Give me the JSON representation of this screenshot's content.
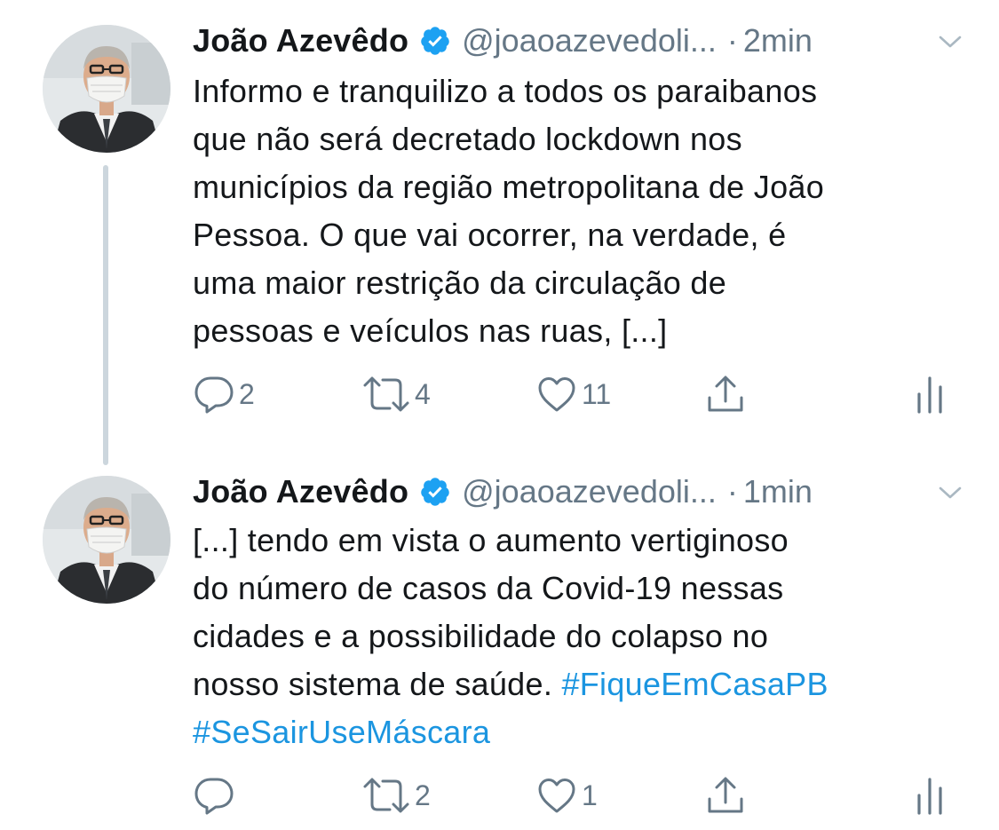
{
  "tweets": [
    {
      "author_name": "João Azevêdo",
      "handle": "@joaoazevedoli...",
      "separator": "·",
      "time": "2min",
      "text_lines": [
        "Informo e tranquilizo a todos os paraibanos",
        "que não será decretado lockdown nos",
        "municípios da região metropolitana de João",
        "Pessoa. O que vai ocorrer, na verdade, é",
        "uma maior restrição da circulação de",
        "pessoas e veículos nas ruas, [...]"
      ],
      "replies": "2",
      "retweets": "4",
      "likes": "11"
    },
    {
      "author_name": "João Azevêdo",
      "handle": "@joaoazevedoli...",
      "separator": "·",
      "time": "1min",
      "text_lines": [
        "[...] tendo em vista o aumento vertiginoso",
        "do número de casos da Covid-19 nessas",
        "cidades e a possibilidade do colapso no",
        "nosso sistema de saúde. "
      ],
      "hashtag_1": "#FiqueEmCasaPB",
      "hashtag_2": "#SeSairUseMáscara",
      "replies": "",
      "retweets": "2",
      "likes": "1"
    }
  ],
  "colors": {
    "text": "#14171a",
    "secondary": "#657786",
    "link": "#1b95e0",
    "verified": "#1da1f2",
    "thread_line": "#ccd6dd"
  },
  "icons": [
    "reply-icon",
    "retweet-icon",
    "like-icon",
    "share-icon",
    "analytics-icon",
    "verified-badge-icon",
    "chevron-down-icon"
  ]
}
